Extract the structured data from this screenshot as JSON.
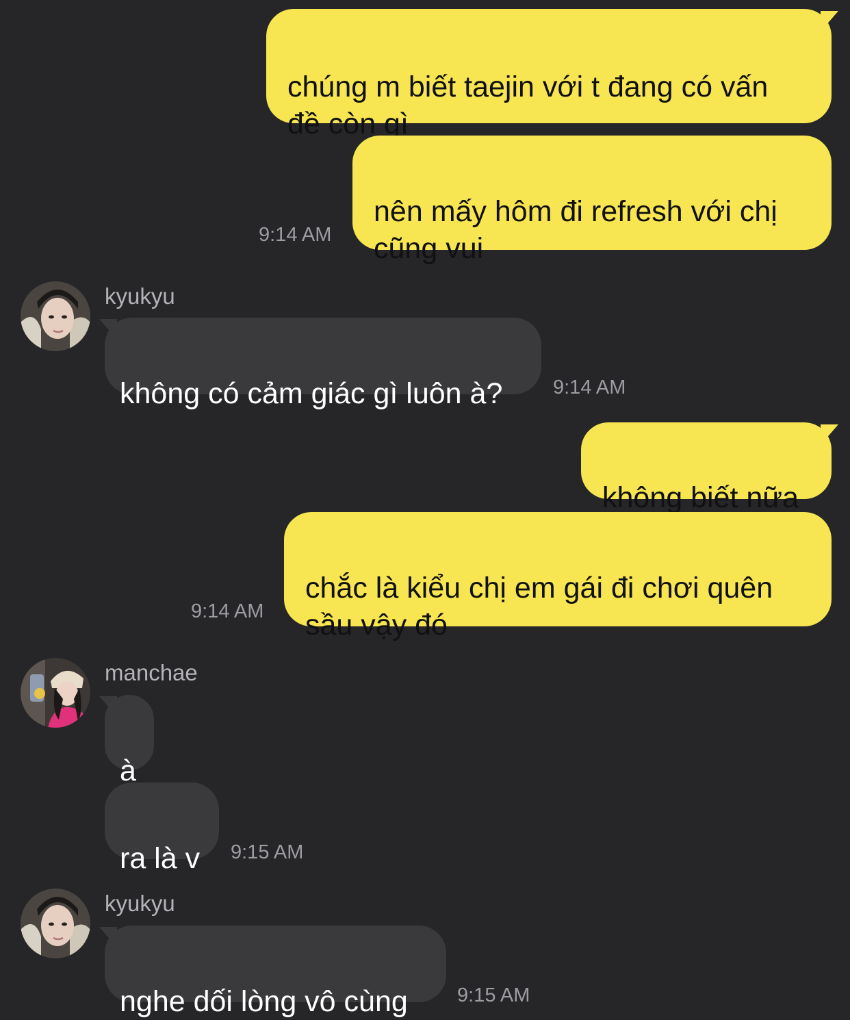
{
  "messages": [
    {
      "text": "chúng m biết taejin với t đang có vấn\nđề còn gì"
    },
    {
      "text": "nên mấy hôm đi refresh với chị\ncũng vui",
      "time": "9:14 AM"
    },
    {
      "sender": "kyukyu",
      "text": "không có cảm giác gì luôn à?",
      "time": "9:14 AM"
    },
    {
      "text": "không biết nữa"
    },
    {
      "text": "chắc là kiểu chị em gái đi chơi quên\nsầu vậy đó",
      "time": "9:14 AM"
    },
    {
      "sender": "manchae",
      "text": "à"
    },
    {
      "text": "ra là v",
      "time": "9:15 AM"
    },
    {
      "sender": "kyukyu",
      "text": "nghe dối lòng vô cùng",
      "time": "9:15 AM"
    }
  ],
  "colors": {
    "background": "#262629",
    "sent_bubble": "#f8e552",
    "received_bubble": "#3a3a3d",
    "timestamp": "#9c9ca2"
  },
  "icons": {
    "avatar_kyukyu": "avatar-photo",
    "avatar_manchae": "avatar-photo"
  }
}
